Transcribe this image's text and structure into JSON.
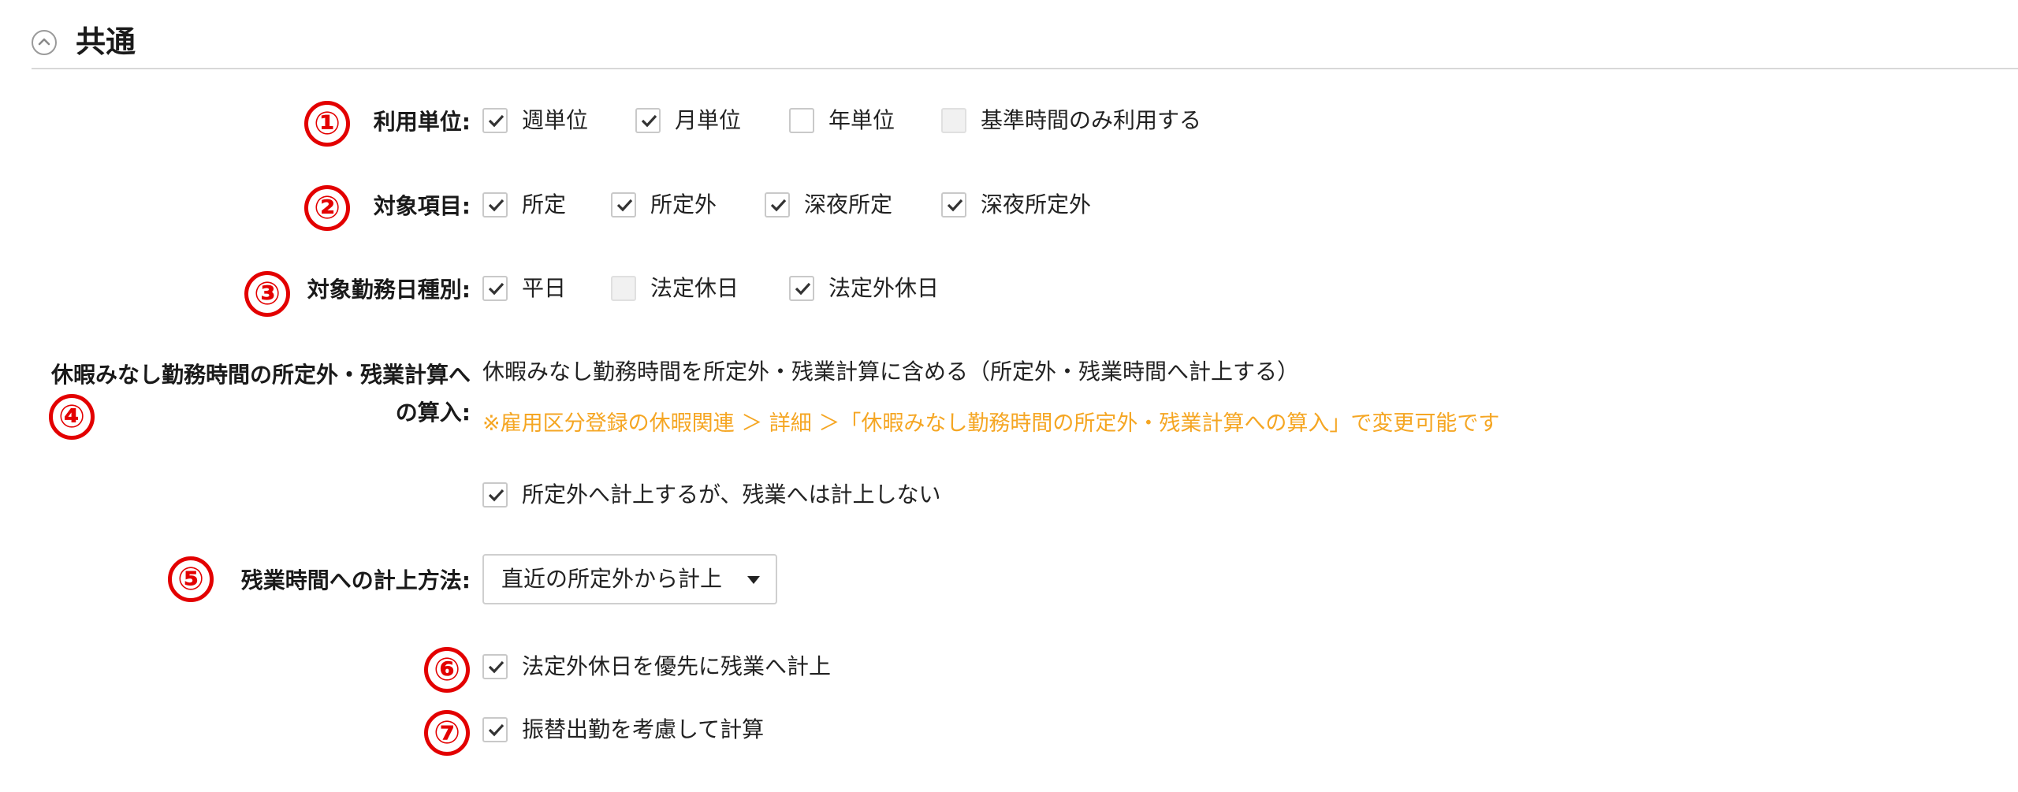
{
  "section": {
    "title": "共通",
    "collapse_icon": "chevron-up-icon"
  },
  "colors": {
    "badge": "#e30000",
    "note": "#f5a623",
    "check": "#333333"
  },
  "rows": {
    "unit": {
      "badge": "①",
      "label": "利用単位:",
      "options": [
        {
          "label": "週単位",
          "checked": true,
          "disabled": false
        },
        {
          "label": "月単位",
          "checked": true,
          "disabled": false
        },
        {
          "label": "年単位",
          "checked": false,
          "disabled": false
        },
        {
          "label": "基準時間のみ利用する",
          "checked": false,
          "disabled": true
        }
      ]
    },
    "items": {
      "badge": "②",
      "label": "対象項目:",
      "options": [
        {
          "label": "所定",
          "checked": true
        },
        {
          "label": "所定外",
          "checked": true
        },
        {
          "label": "深夜所定",
          "checked": true
        },
        {
          "label": "深夜所定外",
          "checked": true
        }
      ]
    },
    "daytype": {
      "badge": "③",
      "label": "対象勤務日種別:",
      "options": [
        {
          "label": "平日",
          "checked": true,
          "disabled": false
        },
        {
          "label": "法定休日",
          "checked": false,
          "disabled": true
        },
        {
          "label": "法定外休日",
          "checked": true,
          "disabled": false
        }
      ]
    },
    "leave": {
      "badge": "④",
      "label_line1": "休暇みなし勤務時間の所定外・残業計算へ",
      "label_line2": "の算入:",
      "description": "休暇みなし勤務時間を所定外・残業計算に含める（所定外・残業時間へ計上する）",
      "note": "※雇用区分登録の休暇関連 ＞ 詳細 ＞「休暇みなし勤務時間の所定外・残業計算への算入」で変更可能です",
      "option": {
        "label": "所定外へ計上するが、残業へは計上しない",
        "checked": true
      }
    },
    "method": {
      "badge": "⑤",
      "label": "残業時間への計上方法:",
      "selected": "直近の所定外から計上",
      "arrow_icon": "caret-down-icon"
    },
    "priority": {
      "badge": "⑥",
      "option": {
        "label": "法定外休日を優先に残業へ計上",
        "checked": true
      }
    },
    "substitute": {
      "badge": "⑦",
      "option": {
        "label": "振替出勤を考慮して計算",
        "checked": true
      }
    }
  }
}
